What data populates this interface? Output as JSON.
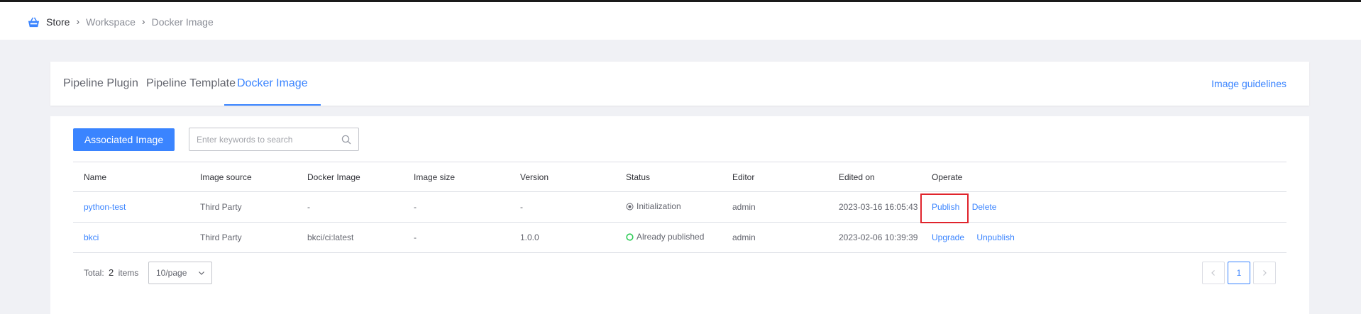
{
  "breadcrumb": {
    "store": "Store",
    "workspace": "Workspace",
    "current": "Docker Image"
  },
  "tabs": [
    {
      "label": "Pipeline Plugin"
    },
    {
      "label": "Pipeline Template"
    },
    {
      "label": "Docker Image"
    }
  ],
  "guidelines_link": "Image guidelines",
  "toolbar": {
    "associate_label": "Associated Image",
    "search_placeholder": "Enter keywords to search"
  },
  "table": {
    "headers": [
      "Name",
      "Image source",
      "Docker Image",
      "Image size",
      "Version",
      "Status",
      "Editor",
      "Edited on",
      "Operate"
    ],
    "rows": [
      {
        "name": "python-test",
        "source": "Third Party",
        "image": "-",
        "size": "-",
        "version": "-",
        "status": "Initialization",
        "editor": "admin",
        "edited": "2023-03-16 16:05:43",
        "ops": [
          "Publish",
          "Delete"
        ]
      },
      {
        "name": "bkci",
        "source": "Third Party",
        "image": "bkci/ci:latest",
        "size": "-",
        "version": "1.0.0",
        "status": "Already published",
        "editor": "admin",
        "edited": "2023-02-06 10:39:39",
        "ops": [
          "Upgrade",
          "Unpublish"
        ]
      }
    ]
  },
  "pagination": {
    "total_prefix": "Total:",
    "total_count": "2",
    "total_suffix": "items",
    "page_size": "10/page",
    "current_page": "1"
  },
  "colors": {
    "accent": "#3a84ff",
    "highlight_box": "#e0242c",
    "published_status": "#2dcb56"
  },
  "icons": {
    "store": "store-basket-icon",
    "search": "search-icon",
    "status_init": "circle-dot-icon",
    "status_published": "circle-outline-icon"
  }
}
